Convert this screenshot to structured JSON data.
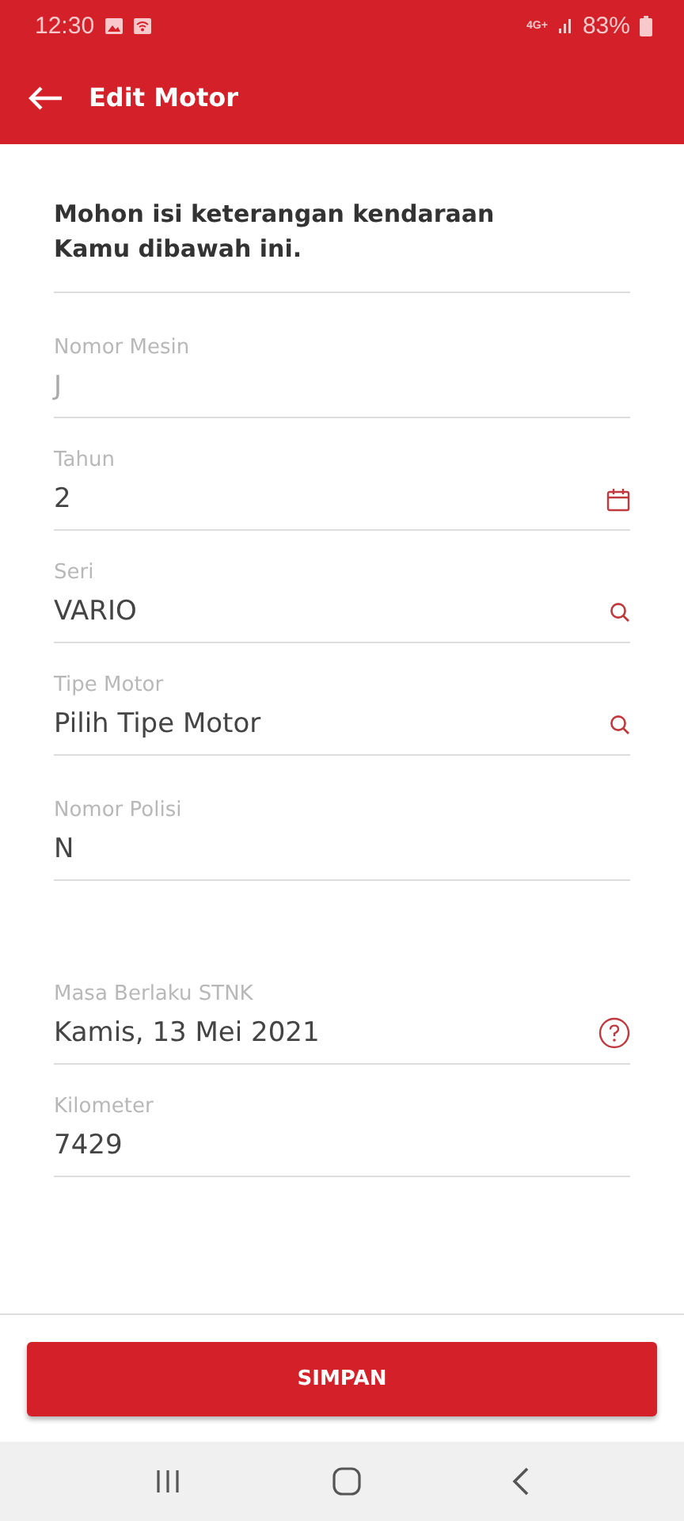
{
  "status_bar": {
    "time": "12:30",
    "network": "4G+",
    "battery": "83%"
  },
  "app_bar": {
    "title": "Edit Motor"
  },
  "intro": "Mohon isi keterangan kendaraan Kamu dibawah ini.",
  "fields": [
    {
      "kind": "text",
      "label": "Nomor Mesin",
      "value": "J",
      "disabled": true
    },
    {
      "kind": "date",
      "label": "Tahun",
      "value": "2",
      "disabled": false
    },
    {
      "kind": "search",
      "label": "Seri",
      "value": "VARIO",
      "disabled": false
    },
    {
      "kind": "search",
      "label": "Tipe Motor",
      "value": "Pilih Tipe Motor",
      "disabled": false
    },
    {
      "kind": "text",
      "label": "Nomor Polisi",
      "value": "N",
      "disabled": false
    },
    {
      "kind": "help",
      "label": "Masa Berlaku STNK",
      "value": "Kamis, 13 Mei 2021",
      "disabled": false
    },
    {
      "kind": "text",
      "label": "Kilometer",
      "value": "7429",
      "disabled": false
    }
  ],
  "save_button": "SIMPAN"
}
